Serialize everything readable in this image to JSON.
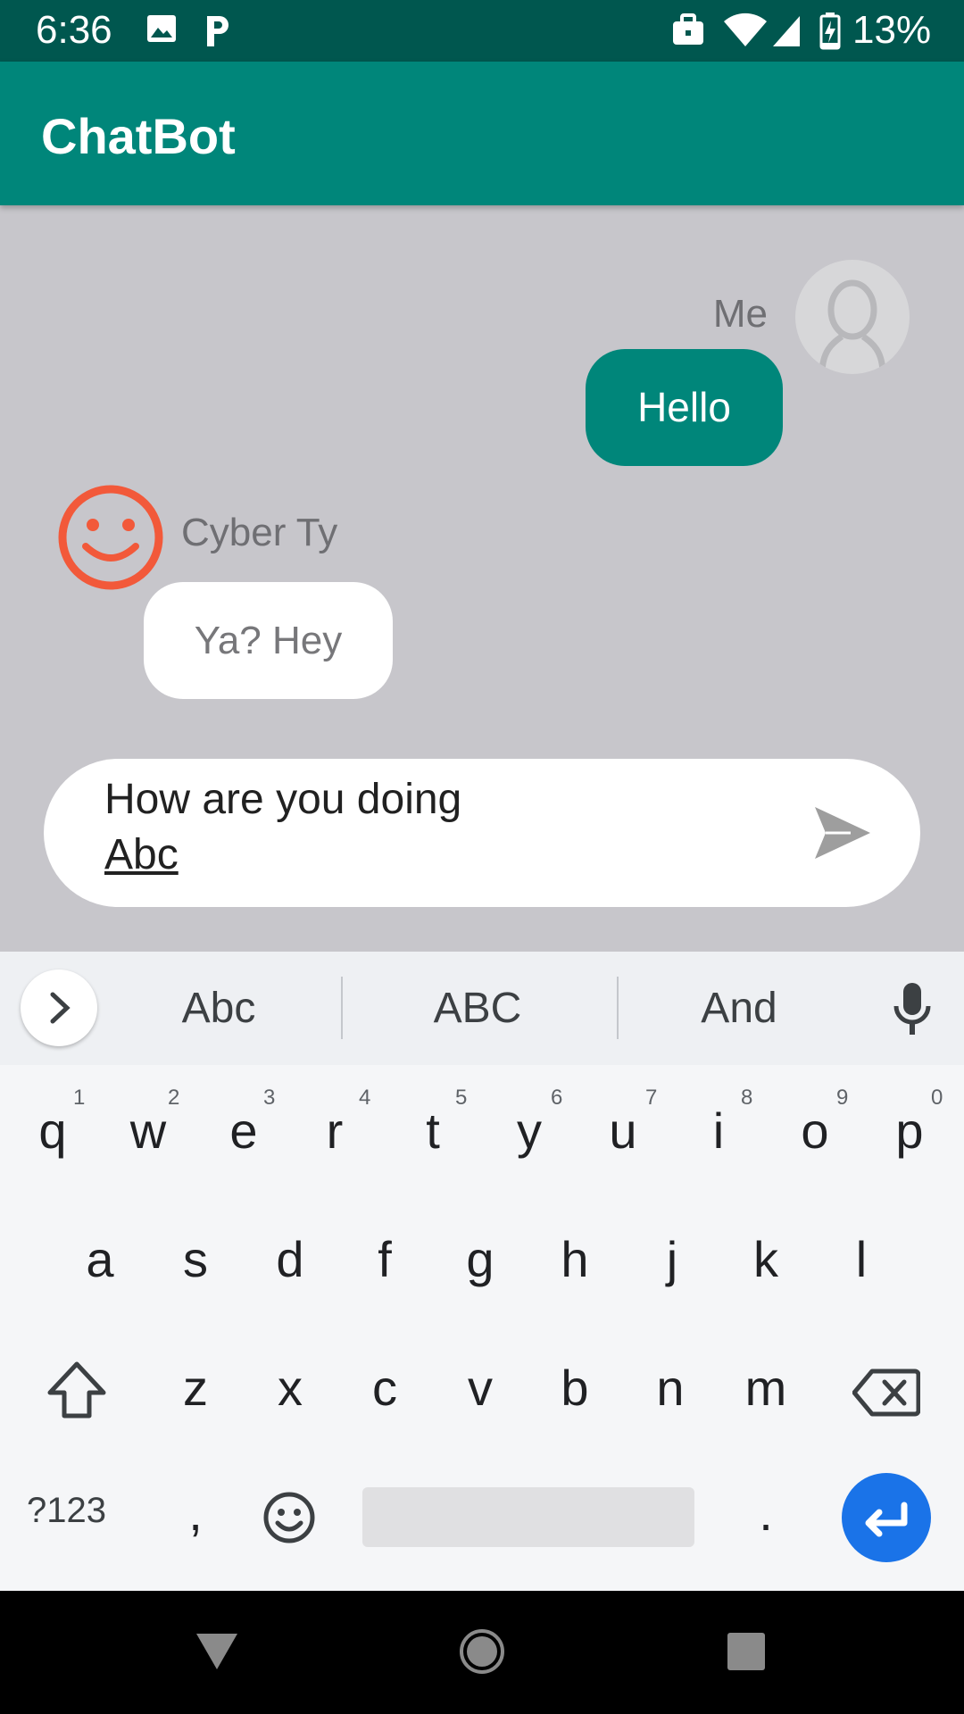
{
  "status_bar": {
    "time": "6:36",
    "battery": "13%",
    "icons": [
      "image-icon",
      "parking-icon",
      "work-profile-icon",
      "wifi-icon",
      "signal-icon",
      "battery-charging-icon"
    ]
  },
  "app_bar": {
    "title": "ChatBot"
  },
  "chat": {
    "me": {
      "name": "Me",
      "message": "Hello",
      "avatar": "person-placeholder-icon"
    },
    "bot": {
      "name": "Cyber Ty",
      "message": "Ya? Hey",
      "avatar": "smiley-icon"
    }
  },
  "composer": {
    "line1": "How are you doing",
    "line2": "Abc",
    "send_icon": "send-icon"
  },
  "keyboard": {
    "suggestions": [
      "Abc",
      "ABC",
      "And"
    ],
    "row1": [
      "q",
      "w",
      "e",
      "r",
      "t",
      "y",
      "u",
      "i",
      "o",
      "p"
    ],
    "row1_hints": [
      "1",
      "2",
      "3",
      "4",
      "5",
      "6",
      "7",
      "8",
      "9",
      "0"
    ],
    "row2": [
      "a",
      "s",
      "d",
      "f",
      "g",
      "h",
      "j",
      "k",
      "l"
    ],
    "row3": [
      "z",
      "x",
      "c",
      "v",
      "b",
      "n",
      "m"
    ],
    "symbols_label": "?123",
    "comma": ",",
    "period": ".",
    "accent_color": "#1a73e8"
  },
  "colors": {
    "primary": "#00867a",
    "primary_dark": "#00574f",
    "bot_avatar": "#f2593a"
  }
}
